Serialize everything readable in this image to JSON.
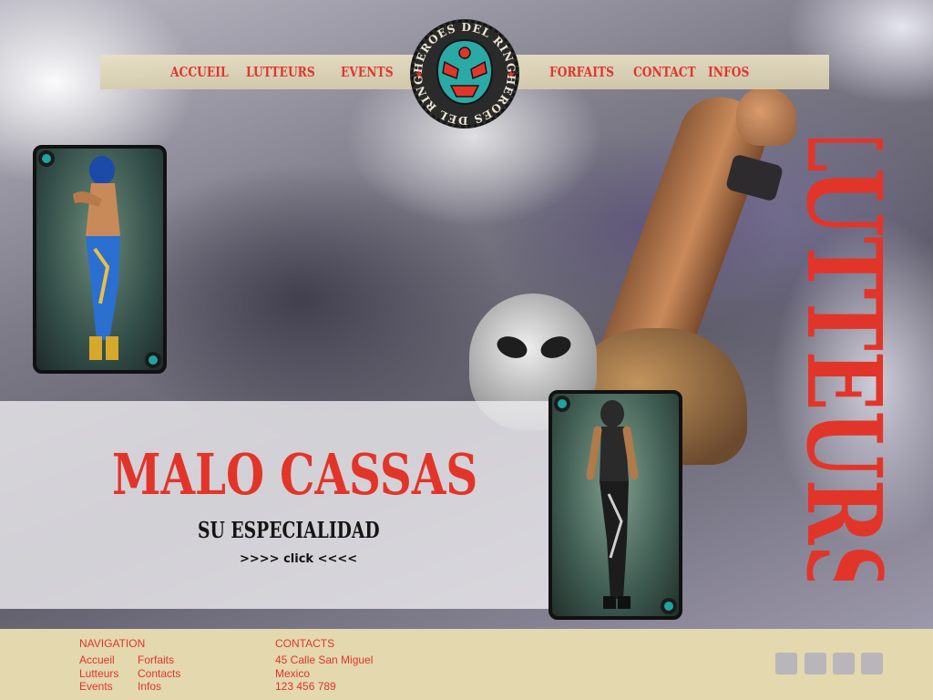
{
  "nav": {
    "left": [
      {
        "label": "ACCUEIL"
      },
      {
        "label": "LUTTEURS"
      },
      {
        "label": "EVENTS"
      }
    ],
    "right": [
      {
        "label": "FORFAITS"
      },
      {
        "label": "CONTACT"
      },
      {
        "label": "INFOS"
      }
    ]
  },
  "logo": {
    "text_top": "HEROES DEL RING",
    "text_bottom": "HEROES DEL RING",
    "icon": "luchador-mask-icon"
  },
  "page_heading": "LUTTEURS",
  "feature": {
    "name": "MALO CASSAS",
    "subtitle": "SU ESPECIALIDAD",
    "link_label": ">>>> click <<<<"
  },
  "cards": [
    {
      "icon": "wrestler-photo",
      "corner_icons": [
        "mask-badge-icon",
        "mask-badge-icon"
      ]
    },
    {
      "icon": "wrestler-photo",
      "corner_icons": [
        "mask-badge-icon",
        "mask-badge-icon"
      ]
    }
  ],
  "footer": {
    "navigation": {
      "heading": "NAVIGATION",
      "col1": [
        "Accueil",
        "Lutteurs",
        "Events"
      ],
      "col2": [
        "Forfaits",
        "Contacts",
        "Infos"
      ]
    },
    "contacts": {
      "heading": "CONTACTS",
      "lines": [
        "45 Calle San Miguel",
        "Mexico",
        "123 456 789"
      ]
    },
    "social": [
      "social-icon-1",
      "social-icon-2",
      "social-icon-3",
      "social-icon-4"
    ]
  },
  "colors": {
    "accent": "#e2352a",
    "nav_bar": "#e0d6b4",
    "footer": "#e3d8ae",
    "logo_teal": "#2ba9a6"
  }
}
